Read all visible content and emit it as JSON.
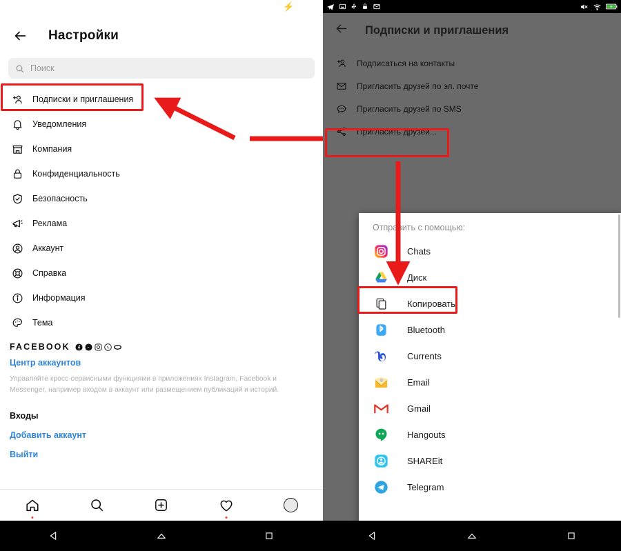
{
  "left_panel": {
    "status": {
      "charging_icon": "charging-bolt-icon"
    },
    "header": {
      "back_icon": "back-arrow-icon",
      "title": "Настройки"
    },
    "search": {
      "icon": "search-icon",
      "placeholder": "Поиск"
    },
    "menu_items": [
      {
        "icon": "follow-person-icon",
        "label": "Подписки и приглашения",
        "highlighted": true
      },
      {
        "icon": "bell-icon",
        "label": "Уведомления"
      },
      {
        "icon": "store-icon",
        "label": "Компания"
      },
      {
        "icon": "lock-icon",
        "label": "Конфиденциальность"
      },
      {
        "icon": "shield-check-icon",
        "label": "Безопасность"
      },
      {
        "icon": "megaphone-icon",
        "label": "Реклама"
      },
      {
        "icon": "account-circle-icon",
        "label": "Аккаунт"
      },
      {
        "icon": "lifebuoy-icon",
        "label": "Справка"
      },
      {
        "icon": "info-icon",
        "label": "Информация"
      },
      {
        "icon": "palette-icon",
        "label": "Тема"
      }
    ],
    "facebook": {
      "word": "FACEBOOK",
      "brand_icons": [
        "facebook-icon",
        "messenger-icon",
        "instagram-icon",
        "whatsapp-icon",
        "oculus-icon"
      ],
      "accounts_center_link": "Центр аккаунтов",
      "description": "Управляйте кросс-сервисными функциями в приложениях Instagram, Facebook и Messenger, например входом в аккаунт или размещением публикаций и историй.",
      "logins_heading": "Входы",
      "add_account_link": "Добавить аккаунт",
      "logout_link": "Выйти"
    },
    "bottom_nav": [
      {
        "icon": "home-icon",
        "has_dot": true
      },
      {
        "icon": "search-icon",
        "has_dot": false
      },
      {
        "icon": "add-post-icon",
        "has_dot": false
      },
      {
        "icon": "heart-icon",
        "has_dot": true
      },
      {
        "icon": "avatar-icon",
        "has_dot": false
      }
    ],
    "system_nav": [
      "back-triangle-icon",
      "home-pentagon-icon",
      "recents-square-icon"
    ]
  },
  "right_panel": {
    "status_bar": {
      "left_icons": [
        "telegram-icon",
        "screenshot-icon",
        "usb-icon",
        "lock-icon",
        "mail-icon"
      ],
      "right_icons": [
        "mute-icon",
        "wifi-icon",
        "battery-charging-icon"
      ]
    },
    "header": {
      "back_icon": "back-arrow-icon",
      "title": "Подписки и приглашения"
    },
    "menu_items": [
      {
        "icon": "follow-person-icon",
        "label": "Подписаться на контакты"
      },
      {
        "icon": "envelope-icon",
        "label": "Пригласить друзей по эл. почте"
      },
      {
        "icon": "sms-bubble-icon",
        "label": "Пригласить друзей по SMS"
      },
      {
        "icon": "share-nodes-icon",
        "label": "Пригласить друзей...",
        "highlighted": true
      }
    ],
    "share_dialog": {
      "title": "Отправить с помощью:",
      "items": [
        {
          "icon": "instagram-icon",
          "label": "Chats",
          "color": "#e1306c"
        },
        {
          "icon": "google-drive-icon",
          "label": "Диск",
          "color": "#1da462"
        },
        {
          "icon": "copy-icon",
          "label": "Копировать",
          "color": "#444444",
          "highlighted": true
        },
        {
          "icon": "bluetooth-icon",
          "label": "Bluetooth",
          "color": "#3fa9f5"
        },
        {
          "icon": "currents-icon",
          "label": "Currents",
          "color": "#2c55d6"
        },
        {
          "icon": "email-icon",
          "label": "Email",
          "color": "#f5b932"
        },
        {
          "icon": "gmail-icon",
          "label": "Gmail",
          "color": "#e63329"
        },
        {
          "icon": "hangouts-icon",
          "label": "Hangouts",
          "color": "#12a657"
        },
        {
          "icon": "shareit-icon",
          "label": "SHAREit",
          "color": "#2ec4f0"
        },
        {
          "icon": "telegram-icon",
          "label": "Telegram",
          "color": "#2ca5e0"
        }
      ]
    },
    "system_nav": [
      "back-triangle-icon",
      "home-pentagon-icon",
      "recents-square-icon"
    ]
  },
  "annotations": {
    "accent_color": "#e81a1a",
    "arrows": [
      "diagonal-arrow-up-left",
      "horizontal-arrow-right",
      "vertical-arrow-down"
    ],
    "highlight_boxes": [
      "subscriptions-item-box",
      "invite-friends-item-box",
      "copy-item-box"
    ]
  }
}
